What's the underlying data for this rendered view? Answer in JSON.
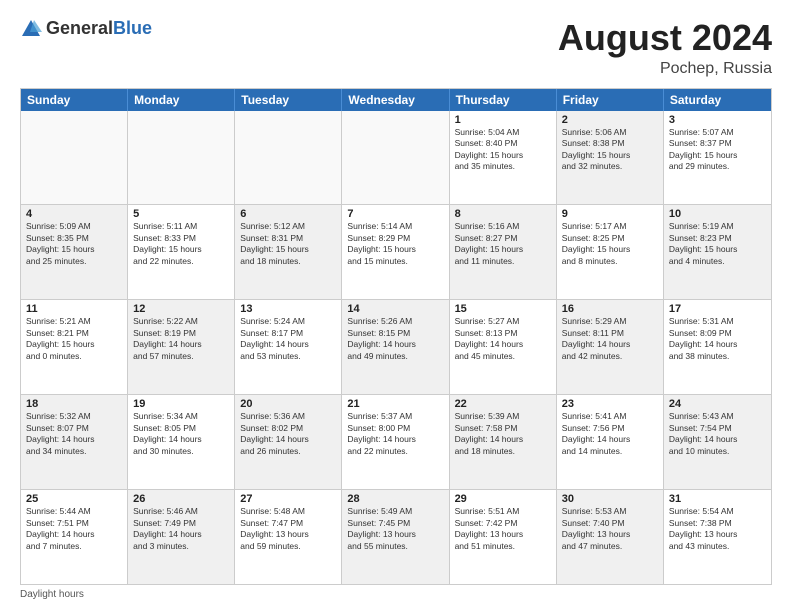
{
  "logo": {
    "general": "General",
    "blue": "Blue"
  },
  "title": "August 2024",
  "subtitle": "Pochep, Russia",
  "days": [
    "Sunday",
    "Monday",
    "Tuesday",
    "Wednesday",
    "Thursday",
    "Friday",
    "Saturday"
  ],
  "weeks": [
    [
      {
        "day": "",
        "text": "",
        "empty": true
      },
      {
        "day": "",
        "text": "",
        "empty": true
      },
      {
        "day": "",
        "text": "",
        "empty": true
      },
      {
        "day": "",
        "text": "",
        "empty": true
      },
      {
        "day": "1",
        "text": "Sunrise: 5:04 AM\nSunset: 8:40 PM\nDaylight: 15 hours\nand 35 minutes.",
        "shaded": false
      },
      {
        "day": "2",
        "text": "Sunrise: 5:06 AM\nSunset: 8:38 PM\nDaylight: 15 hours\nand 32 minutes.",
        "shaded": true
      },
      {
        "day": "3",
        "text": "Sunrise: 5:07 AM\nSunset: 8:37 PM\nDaylight: 15 hours\nand 29 minutes.",
        "shaded": false
      }
    ],
    [
      {
        "day": "4",
        "text": "Sunrise: 5:09 AM\nSunset: 8:35 PM\nDaylight: 15 hours\nand 25 minutes.",
        "shaded": true
      },
      {
        "day": "5",
        "text": "Sunrise: 5:11 AM\nSunset: 8:33 PM\nDaylight: 15 hours\nand 22 minutes.",
        "shaded": false
      },
      {
        "day": "6",
        "text": "Sunrise: 5:12 AM\nSunset: 8:31 PM\nDaylight: 15 hours\nand 18 minutes.",
        "shaded": true
      },
      {
        "day": "7",
        "text": "Sunrise: 5:14 AM\nSunset: 8:29 PM\nDaylight: 15 hours\nand 15 minutes.",
        "shaded": false
      },
      {
        "day": "8",
        "text": "Sunrise: 5:16 AM\nSunset: 8:27 PM\nDaylight: 15 hours\nand 11 minutes.",
        "shaded": true
      },
      {
        "day": "9",
        "text": "Sunrise: 5:17 AM\nSunset: 8:25 PM\nDaylight: 15 hours\nand 8 minutes.",
        "shaded": false
      },
      {
        "day": "10",
        "text": "Sunrise: 5:19 AM\nSunset: 8:23 PM\nDaylight: 15 hours\nand 4 minutes.",
        "shaded": true
      }
    ],
    [
      {
        "day": "11",
        "text": "Sunrise: 5:21 AM\nSunset: 8:21 PM\nDaylight: 15 hours\nand 0 minutes.",
        "shaded": false
      },
      {
        "day": "12",
        "text": "Sunrise: 5:22 AM\nSunset: 8:19 PM\nDaylight: 14 hours\nand 57 minutes.",
        "shaded": true
      },
      {
        "day": "13",
        "text": "Sunrise: 5:24 AM\nSunset: 8:17 PM\nDaylight: 14 hours\nand 53 minutes.",
        "shaded": false
      },
      {
        "day": "14",
        "text": "Sunrise: 5:26 AM\nSunset: 8:15 PM\nDaylight: 14 hours\nand 49 minutes.",
        "shaded": true
      },
      {
        "day": "15",
        "text": "Sunrise: 5:27 AM\nSunset: 8:13 PM\nDaylight: 14 hours\nand 45 minutes.",
        "shaded": false
      },
      {
        "day": "16",
        "text": "Sunrise: 5:29 AM\nSunset: 8:11 PM\nDaylight: 14 hours\nand 42 minutes.",
        "shaded": true
      },
      {
        "day": "17",
        "text": "Sunrise: 5:31 AM\nSunset: 8:09 PM\nDaylight: 14 hours\nand 38 minutes.",
        "shaded": false
      }
    ],
    [
      {
        "day": "18",
        "text": "Sunrise: 5:32 AM\nSunset: 8:07 PM\nDaylight: 14 hours\nand 34 minutes.",
        "shaded": true
      },
      {
        "day": "19",
        "text": "Sunrise: 5:34 AM\nSunset: 8:05 PM\nDaylight: 14 hours\nand 30 minutes.",
        "shaded": false
      },
      {
        "day": "20",
        "text": "Sunrise: 5:36 AM\nSunset: 8:02 PM\nDaylight: 14 hours\nand 26 minutes.",
        "shaded": true
      },
      {
        "day": "21",
        "text": "Sunrise: 5:37 AM\nSunset: 8:00 PM\nDaylight: 14 hours\nand 22 minutes.",
        "shaded": false
      },
      {
        "day": "22",
        "text": "Sunrise: 5:39 AM\nSunset: 7:58 PM\nDaylight: 14 hours\nand 18 minutes.",
        "shaded": true
      },
      {
        "day": "23",
        "text": "Sunrise: 5:41 AM\nSunset: 7:56 PM\nDaylight: 14 hours\nand 14 minutes.",
        "shaded": false
      },
      {
        "day": "24",
        "text": "Sunrise: 5:43 AM\nSunset: 7:54 PM\nDaylight: 14 hours\nand 10 minutes.",
        "shaded": true
      }
    ],
    [
      {
        "day": "25",
        "text": "Sunrise: 5:44 AM\nSunset: 7:51 PM\nDaylight: 14 hours\nand 7 minutes.",
        "shaded": false
      },
      {
        "day": "26",
        "text": "Sunrise: 5:46 AM\nSunset: 7:49 PM\nDaylight: 14 hours\nand 3 minutes.",
        "shaded": true
      },
      {
        "day": "27",
        "text": "Sunrise: 5:48 AM\nSunset: 7:47 PM\nDaylight: 13 hours\nand 59 minutes.",
        "shaded": false
      },
      {
        "day": "28",
        "text": "Sunrise: 5:49 AM\nSunset: 7:45 PM\nDaylight: 13 hours\nand 55 minutes.",
        "shaded": true
      },
      {
        "day": "29",
        "text": "Sunrise: 5:51 AM\nSunset: 7:42 PM\nDaylight: 13 hours\nand 51 minutes.",
        "shaded": false
      },
      {
        "day": "30",
        "text": "Sunrise: 5:53 AM\nSunset: 7:40 PM\nDaylight: 13 hours\nand 47 minutes.",
        "shaded": true
      },
      {
        "day": "31",
        "text": "Sunrise: 5:54 AM\nSunset: 7:38 PM\nDaylight: 13 hours\nand 43 minutes.",
        "shaded": false
      }
    ]
  ],
  "footer": "Daylight hours"
}
